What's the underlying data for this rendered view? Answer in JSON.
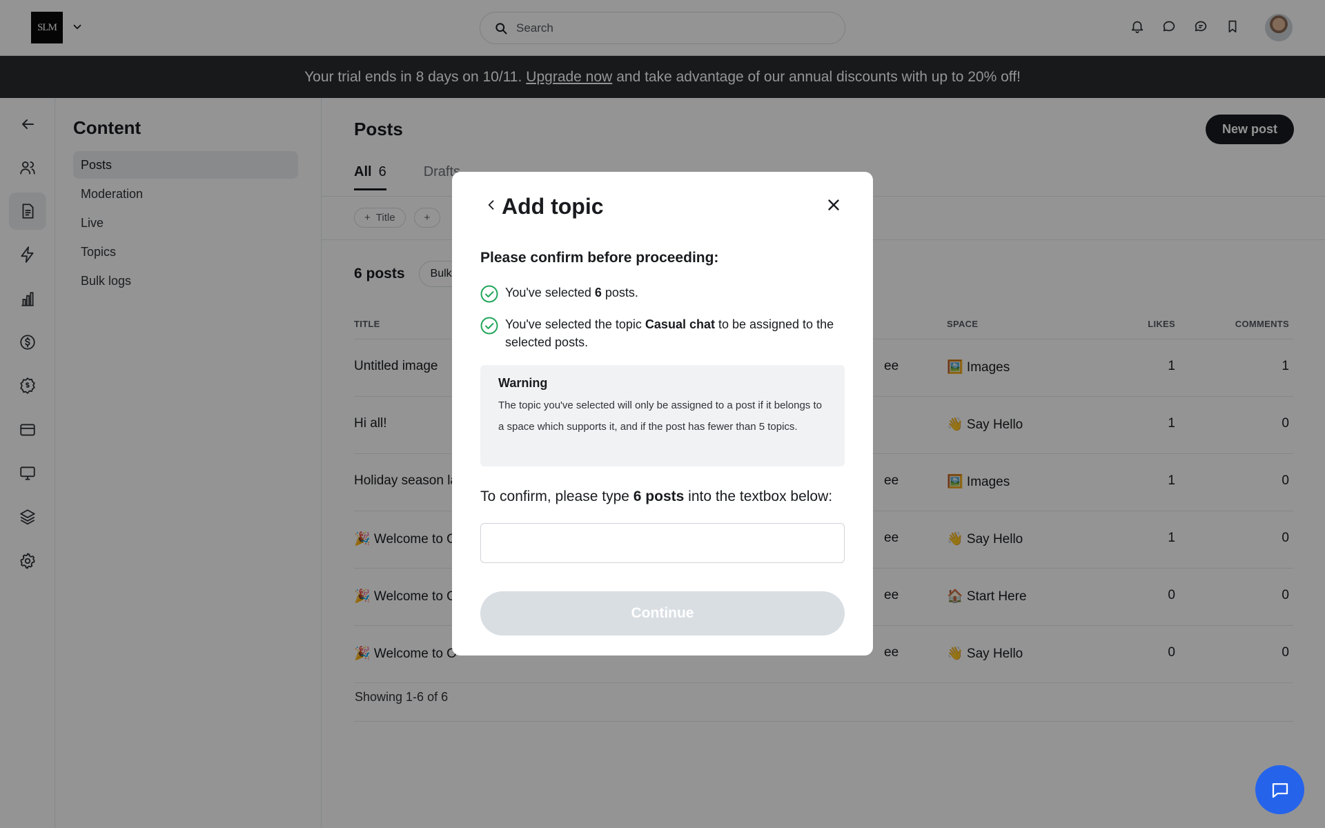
{
  "header": {
    "logo_text": "SLM",
    "search_placeholder": "Search"
  },
  "banner": {
    "prefix": "Your trial ends in 8 days on 10/11.",
    "link": "Upgrade now",
    "suffix": "and take advantage of our annual discounts with up to 20% off!"
  },
  "sidebar": {
    "title": "Content",
    "items": [
      {
        "label": "Posts",
        "active": true
      },
      {
        "label": "Moderation",
        "active": false
      },
      {
        "label": "Live",
        "active": false
      },
      {
        "label": "Topics",
        "active": false
      },
      {
        "label": "Bulk logs",
        "active": false
      }
    ]
  },
  "main": {
    "title": "Posts",
    "new_post_label": "New post",
    "tabs": [
      {
        "label": "All",
        "count": "6"
      },
      {
        "label": "Drafts",
        "count": ""
      }
    ],
    "filters": [
      "Title",
      ""
    ],
    "posts_count": "6 posts",
    "bulk_label": "Bulk",
    "columns": {
      "title": "TITLE",
      "space": "SPACE",
      "likes": "LIKES",
      "comments": "COMMENTS"
    },
    "rows": [
      {
        "title": "Untitled image",
        "author_tail": "ee",
        "space": "🖼️ Images",
        "likes": "1",
        "comments": "1"
      },
      {
        "title": "Hi all!",
        "author_tail": "",
        "space": "👋 Say Hello",
        "likes": "1",
        "comments": "0"
      },
      {
        "title": "Holiday season la",
        "author_tail": "ee",
        "space": "🖼️ Images",
        "likes": "1",
        "comments": "0"
      },
      {
        "title": "🎉 Welcome to O",
        "author_tail": "ee",
        "space": "👋 Say Hello",
        "likes": "1",
        "comments": "0"
      },
      {
        "title": "🎉 Welcome to O",
        "author_tail": "ee",
        "space": "🏠 Start Here",
        "likes": "0",
        "comments": "0"
      },
      {
        "title": "🎉 Welcome to O",
        "author_tail": "ee",
        "space": "👋 Say Hello",
        "likes": "0",
        "comments": "0"
      }
    ],
    "showing": "Showing 1-6 of 6"
  },
  "modal": {
    "title": "Add topic",
    "subtitle": "Please confirm before proceeding:",
    "check1_pre": "You've selected ",
    "check1_bold": "6",
    "check1_post": " posts.",
    "check2_pre": "You've selected the topic ",
    "check2_bold": "Casual chat",
    "check2_post": " to be assigned to the selected posts.",
    "warning_title": "Warning",
    "warning_text": "The topic you've selected will only be assigned to a post if it belongs to a space which supports it, and if the post has fewer than 5 topics.",
    "confirm_pre": "To confirm, please type ",
    "confirm_bold": "6 posts",
    "confirm_post": " into the textbox below:",
    "input_value": "",
    "continue_label": "Continue"
  },
  "colors": {
    "accent_dark": "#191b1f",
    "banner_bg": "#2a2b2e",
    "check_green": "#22a55a",
    "chat_blue": "#2563eb",
    "button_disabled": "#d9dee3"
  }
}
